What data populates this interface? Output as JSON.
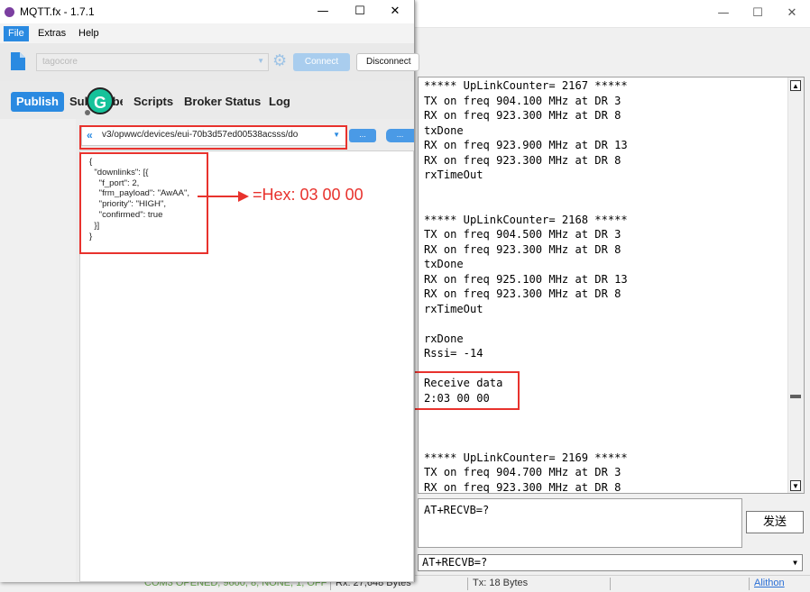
{
  "mqtt": {
    "title": "MQTT.fx - 1.7.1",
    "menu": [
      "File",
      "Extras",
      "Help"
    ],
    "profile": "tagocore",
    "connect_label": "Connect",
    "disconnect_label": "Disconnect",
    "tabs": [
      "Publish",
      "Subscribe",
      "Scripts",
      "Broker Status",
      "Log"
    ],
    "topic": "v3/opwwc/devices/eui-70b3d57ed00538acsss/do",
    "option_button_1": "...",
    "option_button_2": "...",
    "payload": "{\n  \"downlinks\": [{\n    \"f_port\": 2,\n    \"frm_payload\": \"AwAA\",\n    \"priority\": \"HIGH\",\n    \"confirmed\": true\n  }]\n}",
    "grammarly_letter": "G"
  },
  "annotation": {
    "hex_note": "=Hex: 03 00 00",
    "color": "#e8322d"
  },
  "serial": {
    "terminal_text": "***** UpLinkCounter= 2167 *****\nTX on freq 904.100 MHz at DR 3\nRX on freq 923.300 MHz at DR 8\ntxDone\nRX on freq 923.900 MHz at DR 13\nRX on freq 923.300 MHz at DR 8\nrxTimeOut\n\n\n***** UpLinkCounter= 2168 *****\nTX on freq 904.500 MHz at DR 3\nRX on freq 923.300 MHz at DR 8\ntxDone\nRX on freq 925.100 MHz at DR 13\nRX on freq 923.300 MHz at DR 8\nrxTimeOut\n\nrxDone\nRssi= -14\n\nReceive data\n2:03 00 00\n\n\n\n***** UpLinkCounter= 2169 *****\nTX on freq 904.700 MHz at DR 3\nRX on freq 923.300 MHz at DR 8",
    "send_text": "AT+RECVB=?",
    "send_button": "发送",
    "command_select": "AT+RECVB=?",
    "status": {
      "port": "COM3 OPENED, 9600, 8, NONE, 1, OFF",
      "rx": "Rx: 27,648 Bytes",
      "tx": "Tx: 18 Bytes",
      "brand": "Alithon"
    }
  }
}
